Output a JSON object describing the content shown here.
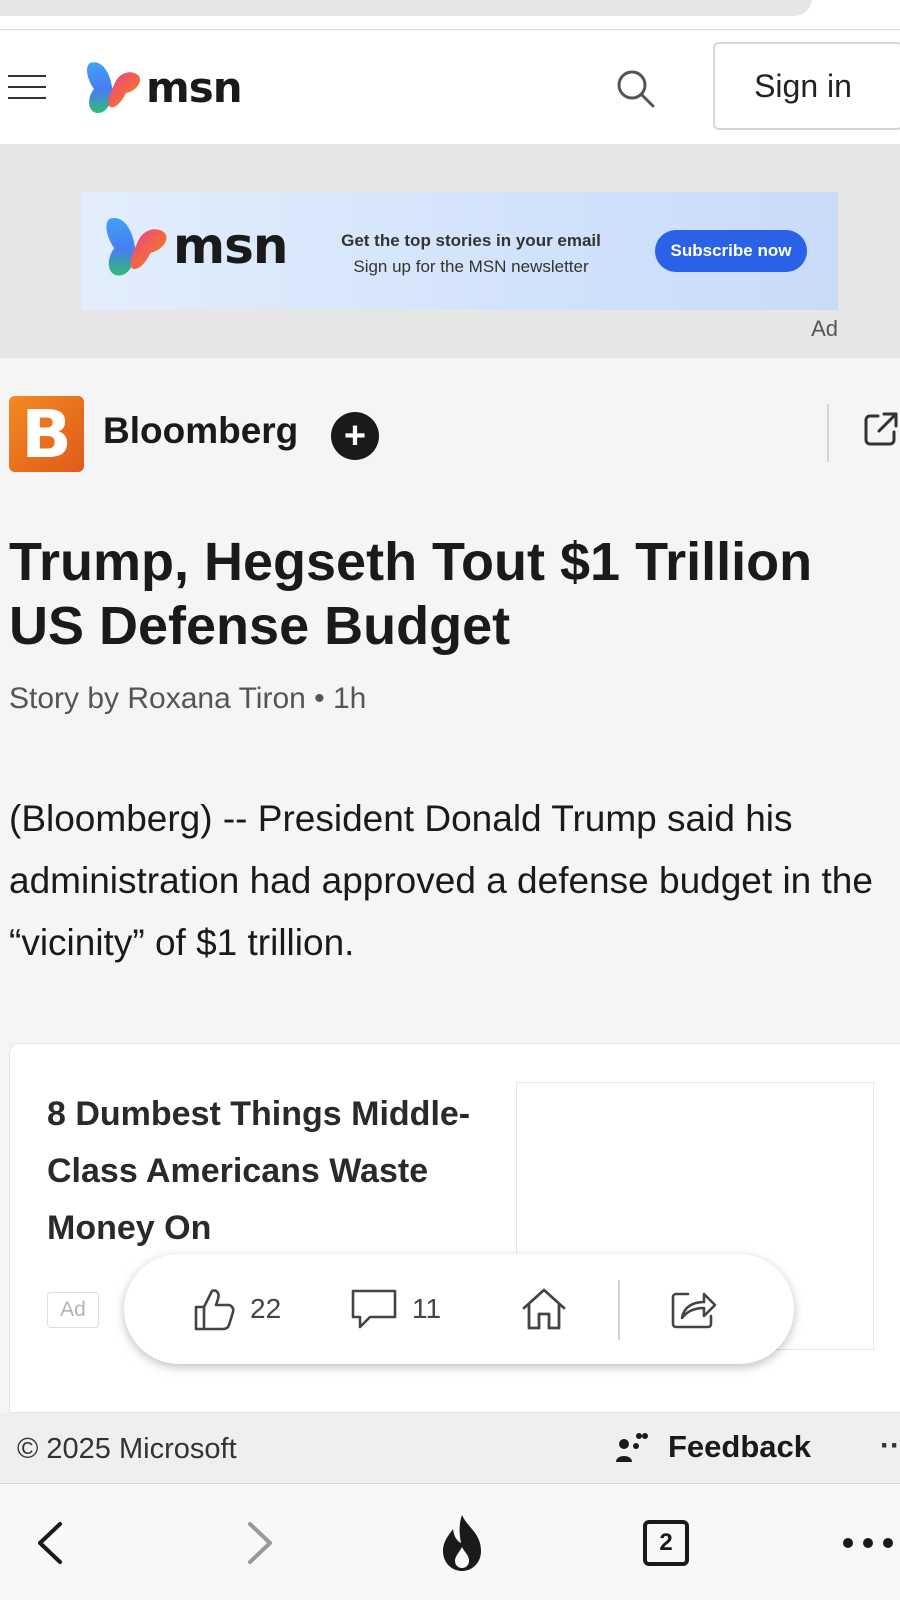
{
  "header": {
    "logo_text": "msn",
    "signin_label": "Sign in"
  },
  "ad_banner": {
    "logo_text": "msn",
    "line1": "Get the top stories in your email",
    "line2": "Sign up for the MSN newsletter",
    "button_label": "Subscribe now",
    "ad_label": "Ad"
  },
  "publisher": {
    "logo_letter": "B",
    "name": "Bloomberg",
    "follow_symbol": "+"
  },
  "article": {
    "headline": "Trump, Hegseth Tout $1 Trillion US Defense Budget",
    "byline": "Story by Roxana Tiron • 1h",
    "body": "(Bloomberg) -- President Donald Trump said his administration had approved a defense budget in the “vicinity” of $1 trillion."
  },
  "promo": {
    "title": "8 Dumbest Things Middle-Class Americans Waste Money On",
    "ad_label": "Ad"
  },
  "actions": {
    "likes": "22",
    "comments": "11"
  },
  "footer": {
    "copyright": "© 2025 Microsoft",
    "feedback_label": "Feedback",
    "more": "··"
  },
  "bottom_bar": {
    "tab_count": "2"
  },
  "colors": {
    "accent_blue": "#2962e6",
    "publisher_orange": "#f28a22",
    "text_primary": "#1a1a1a"
  },
  "icons": [
    "hamburger-menu-icon",
    "msn-butterfly-logo",
    "search-icon",
    "plus-icon",
    "external-link-icon",
    "thumbs-up-icon",
    "comment-icon",
    "home-icon",
    "share-icon",
    "feedback-icon",
    "back-arrow-icon",
    "forward-arrow-icon",
    "fire-icon",
    "tabs-icon",
    "more-icon"
  ]
}
